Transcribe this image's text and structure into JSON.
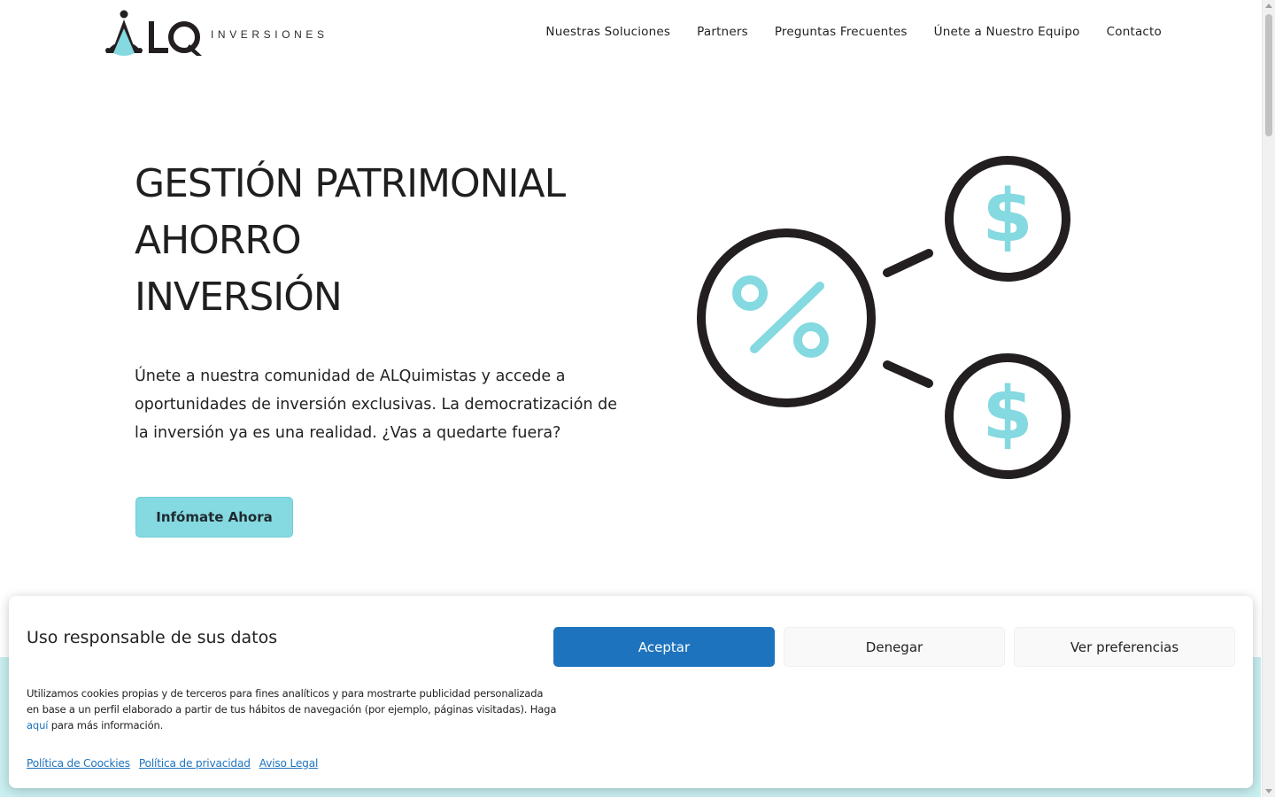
{
  "header": {
    "logo_text": "ALQ",
    "logo_sub": "INVERSIONES",
    "nav": [
      {
        "label": "Nuestras Soluciones"
      },
      {
        "label": "Partners"
      },
      {
        "label": "Preguntas Frecuentes"
      },
      {
        "label": "Únete a Nuestro Equipo"
      },
      {
        "label": "Contacto"
      }
    ]
  },
  "hero": {
    "title_lines": [
      "GESTIÓN PATRIMONIAL",
      "AHORRO",
      "INVERSIÓN"
    ],
    "text": "Únete a nuestra comunidad de ALQuimistas y accede a oportunidades de inversión exclusivas. La democratización de la inversión ya es una realidad. ¿Vas a quedarte fuera?",
    "cta_label": "Infómate Ahora"
  },
  "illustration": {
    "center_icon": "percent-icon",
    "side_icons": [
      "dollar-icon",
      "dollar-icon"
    ],
    "accent_color": "#85d9e0",
    "stroke_color": "#231f20"
  },
  "cookie_banner": {
    "title": "Uso responsable de sus datos",
    "text_before_link": "Utilizamos cookies propias y de terceros para fines analíticos y para mostrarte publicidad personalizada en base a un perfil elaborado a partir de tus hábitos de navegación (por ejemplo, páginas visitadas). Haga ",
    "link_text": "aquí",
    "text_after_link": " para más información.",
    "buttons": {
      "accept": "Aceptar",
      "deny": "Denegar",
      "preferences": "Ver preferencias"
    },
    "links": [
      {
        "label": "Política de Coockies"
      },
      {
        "label": "Política de privacidad"
      },
      {
        "label": "Aviso Legal"
      }
    ]
  },
  "colors": {
    "brand_accent": "#85d9e0",
    "accept_blue": "#1e73be",
    "band_teal": "#c8eef0"
  }
}
